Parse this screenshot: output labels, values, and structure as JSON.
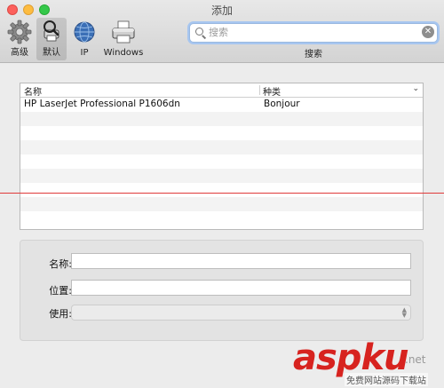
{
  "window": {
    "title": "添加"
  },
  "toolbar": {
    "items": [
      {
        "label": "高级",
        "icon": "gear-icon"
      },
      {
        "label": "默认",
        "icon": "default-printer-icon"
      },
      {
        "label": "IP",
        "icon": "globe-icon"
      },
      {
        "label": "Windows",
        "icon": "windows-printer-icon"
      }
    ],
    "selected": "默认",
    "search": {
      "placeholder": "搜索",
      "value": "",
      "caption": "搜索",
      "clear_glyph": "✕"
    }
  },
  "printer_list": {
    "columns": [
      "名称",
      "种类"
    ],
    "sort_indicator": "⌄",
    "rows": [
      {
        "name": "HP LaserJet Professional P1606dn",
        "kind": "Bonjour"
      },
      {
        "name": "",
        "kind": ""
      },
      {
        "name": "",
        "kind": ""
      },
      {
        "name": "",
        "kind": ""
      },
      {
        "name": "",
        "kind": ""
      },
      {
        "name": "",
        "kind": ""
      },
      {
        "name": "",
        "kind": ""
      },
      {
        "name": "",
        "kind": ""
      },
      {
        "name": "",
        "kind": ""
      }
    ]
  },
  "details": {
    "name_label": "名称:",
    "name_value": "",
    "location_label": "位置:",
    "location_value": "",
    "use_label": "使用:",
    "use_value": ""
  },
  "watermark": {
    "brand_a": "asp",
    "brand_b": "ku",
    "suffix": ".net",
    "tagline": "免费网站源码下载站"
  },
  "colors": {
    "accent": "#a7c6f0",
    "divider_line": "#e03a3a",
    "watermark": "#d7231f"
  }
}
